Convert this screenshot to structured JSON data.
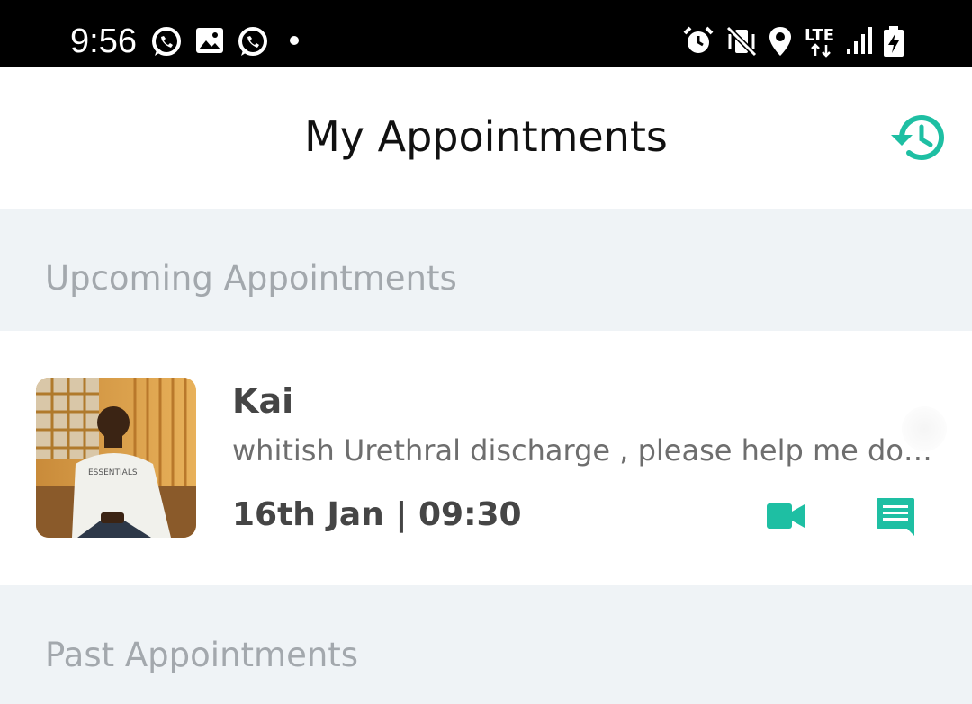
{
  "status_bar": {
    "time": "9:56",
    "left_icons": [
      "whatsapp-icon",
      "gallery-icon",
      "whatsapp-icon"
    ],
    "right_icons": [
      "alarm-icon",
      "vibrate-icon",
      "location-icon",
      "lte-icon",
      "signal-icon",
      "battery-charging-icon"
    ]
  },
  "header": {
    "title": "My Appointments",
    "history_icon": "history-icon"
  },
  "sections": {
    "upcoming_title": "Upcoming Appointments",
    "past_title": "Past Appointments"
  },
  "upcoming": [
    {
      "name": "Kai",
      "reason": "whitish Urethral discharge , please help me doctor",
      "datetime": "16th Jan | 09:30",
      "video_icon": "video-call-icon",
      "chat_icon": "chat-icon"
    }
  ],
  "colors": {
    "accent": "#1ebfa3",
    "status_bar": "#000000",
    "section_bg": "#eff3f6",
    "section_text": "#a3a8ad",
    "primary_text": "#454545"
  }
}
